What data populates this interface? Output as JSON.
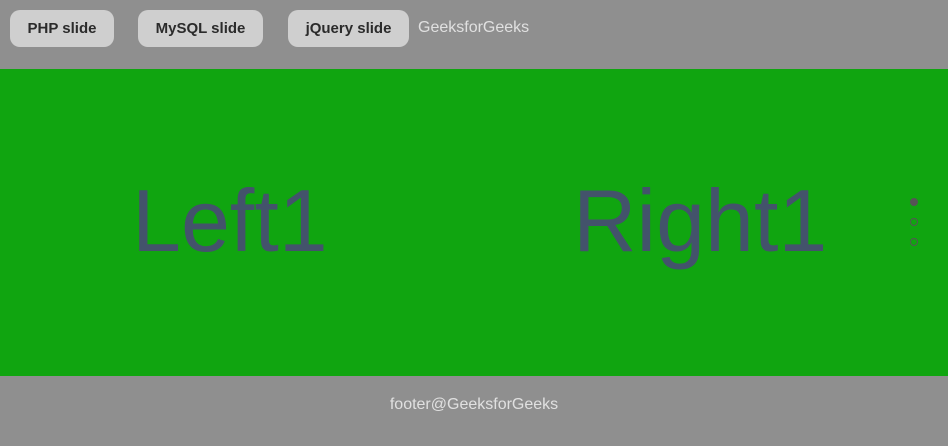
{
  "header": {
    "buttons": [
      {
        "label": "PHP slide"
      },
      {
        "label": "MySQL slide"
      },
      {
        "label": "jQuery slide"
      }
    ],
    "brand": "GeeksforGeeks"
  },
  "slider": {
    "left_text": "Left1",
    "right_text": "Right1",
    "dots_count": 3,
    "active_dot": 1
  },
  "footer": {
    "text": "footer@GeeksforGeeks"
  },
  "colors": {
    "slider_bg": "#10a510",
    "page_bg": "#8f8f8f",
    "slide_text": "#43536b"
  }
}
